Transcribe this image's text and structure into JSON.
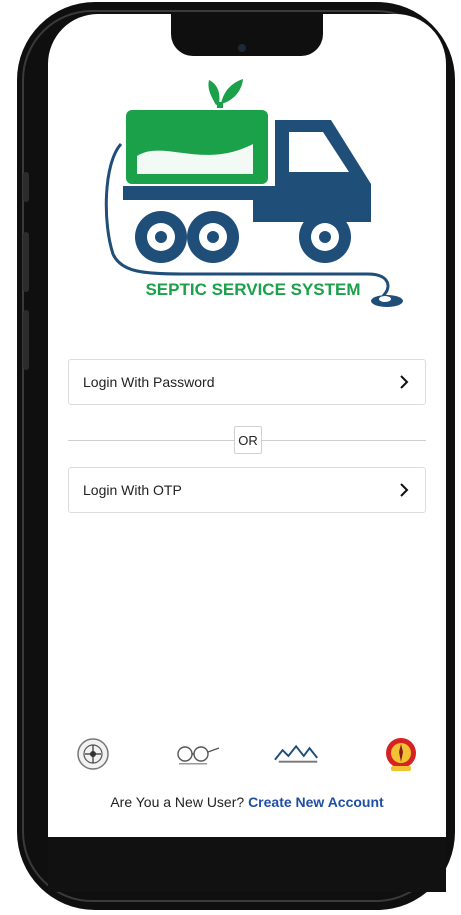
{
  "brand": {
    "name": "SEPTIC SERVICE SYSTEM",
    "colors": {
      "green": "#1aa14a",
      "navy": "#1f4e79"
    }
  },
  "login": {
    "password_label": "Login With Password",
    "or_label": "OR",
    "otp_label": "Login With OTP"
  },
  "partners": [
    {
      "icon": "state-emblem-icon"
    },
    {
      "icon": "spectacles-logo-icon"
    },
    {
      "icon": "mountains-logo-icon"
    },
    {
      "icon": "red-seal-icon"
    }
  ],
  "footer": {
    "prompt": "Are You a New User?",
    "link": "Create New Account"
  }
}
